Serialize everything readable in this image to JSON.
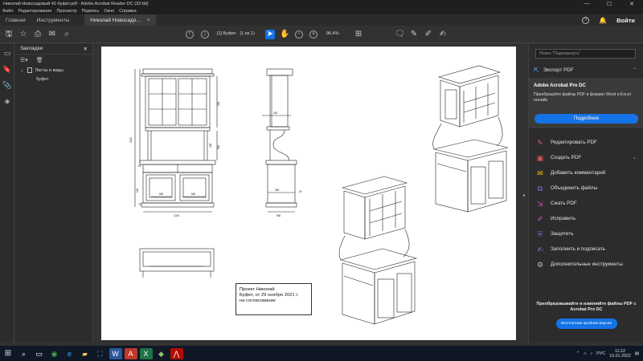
{
  "window": {
    "title": "Николай Новосадовый 41-буфет.pdf - Adobe Acrobat Reader DC (32-bit)",
    "minimize_glyph": "—",
    "maximize_glyph": "☐",
    "close_glyph": "✕"
  },
  "menu": [
    "Файл",
    "Редактирование",
    "Просмотр",
    "Подпись",
    "Окно",
    "Справка"
  ],
  "tabs": {
    "home": "Главная",
    "tools": "Инструменты",
    "document": "Николай Новосадо...",
    "close_glyph": "×"
  },
  "account": {
    "help_glyph": "?",
    "signin": "Войти"
  },
  "toolbar": {
    "page_display": "[1] Буфет",
    "page_count": "(1 из 1)",
    "zoom": "96,4%"
  },
  "left_panel": {
    "title": "Закладки",
    "close_glyph": "✕",
    "bookmarks": [
      {
        "label": "Листы и виды",
        "expanded": true
      },
      {
        "label": "буфет",
        "child": true
      }
    ]
  },
  "document": {
    "caption_lines": [
      "Проект Николай",
      "Буфет, от 29 ноября 2021 г.",
      "на согласование"
    ],
    "dimensions": {
      "total_height": "2100",
      "width_front": "1220",
      "width_side": "560",
      "drawer_width_1": "550",
      "drawer_width_2": "550",
      "upper_height": "900",
      "mid_height": "600",
      "lower_height": "540",
      "top_depth": "330",
      "bottom_depth": "360",
      "side_offset": "30",
      "small_offset": "50",
      "plinth": "70",
      "wall_height": "400"
    }
  },
  "right_panel": {
    "search_placeholder": "Поиск \"Подчеркнуть\"",
    "export_label": "Экспорт PDF",
    "promo": {
      "title": "Adobe Acrobat Pro DC",
      "description": "Преобразуйте файлы PDF в формат Word и Excel онлайн",
      "button": "Подробнее"
    },
    "tools": [
      {
        "label": "Редактировать PDF",
        "icon": "edit-pdf-icon",
        "glyph": "✎",
        "color": "#e34ea6"
      },
      {
        "label": "Создать PDF",
        "icon": "create-pdf-icon",
        "glyph": "▣",
        "color": "#e05050"
      },
      {
        "label": "Добавить комментарий",
        "icon": "comment-icon",
        "glyph": "✉",
        "color": "#f0c400"
      },
      {
        "label": "Объединить файлы",
        "icon": "combine-files-icon",
        "glyph": "⧉",
        "color": "#8c6bd6"
      },
      {
        "label": "Сжать PDF",
        "icon": "compress-pdf-icon",
        "glyph": "⇲",
        "color": "#c452b8"
      },
      {
        "label": "Исправить",
        "icon": "redact-icon",
        "glyph": "✐",
        "color": "#c452b8"
      },
      {
        "label": "Защитить",
        "icon": "protect-icon",
        "glyph": "⛨",
        "color": "#7a6bd6"
      },
      {
        "label": "Заполнить и подписать",
        "icon": "fill-sign-icon",
        "glyph": "✍",
        "color": "#9a7be0"
      },
      {
        "label": "Дополнительные инструменты",
        "icon": "more-tools-icon",
        "glyph": "⚙",
        "color": "#bdbdbd"
      }
    ],
    "bottom_promo": "Преобразовывайте и изменяйте файлы PDF с Acrobat Pro DC",
    "trial_button": "Бесплатная пробная версия"
  },
  "taskbar": {
    "language": "РУС",
    "time": "11:12",
    "date": "15.01.2022"
  },
  "colors": {
    "accent": "#1473e6",
    "panel_bg": "#2c2c2c",
    "app_bg": "#323232",
    "taskbar_bg": "#101826"
  }
}
